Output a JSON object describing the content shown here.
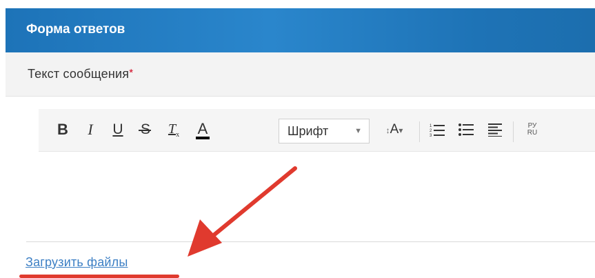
{
  "form": {
    "title": "Форма ответов",
    "message_label": "Текст сообщения",
    "required_mark": "*"
  },
  "toolbar": {
    "bold": "B",
    "italic": "I",
    "underline": "U",
    "strike": "S",
    "remove_format": "T",
    "remove_format_sub": "x",
    "text_color": "A",
    "font_select": "Шрифт",
    "font_size": "A",
    "translit_top": "РУ",
    "translit_bottom": "RU"
  },
  "upload": {
    "link_text": "Загрузить файлы"
  },
  "colors": {
    "header_blue": "#1d73b8",
    "link_blue": "#3c7fc4",
    "annotation_red": "#e03a2e",
    "required_red": "#d0021b"
  }
}
